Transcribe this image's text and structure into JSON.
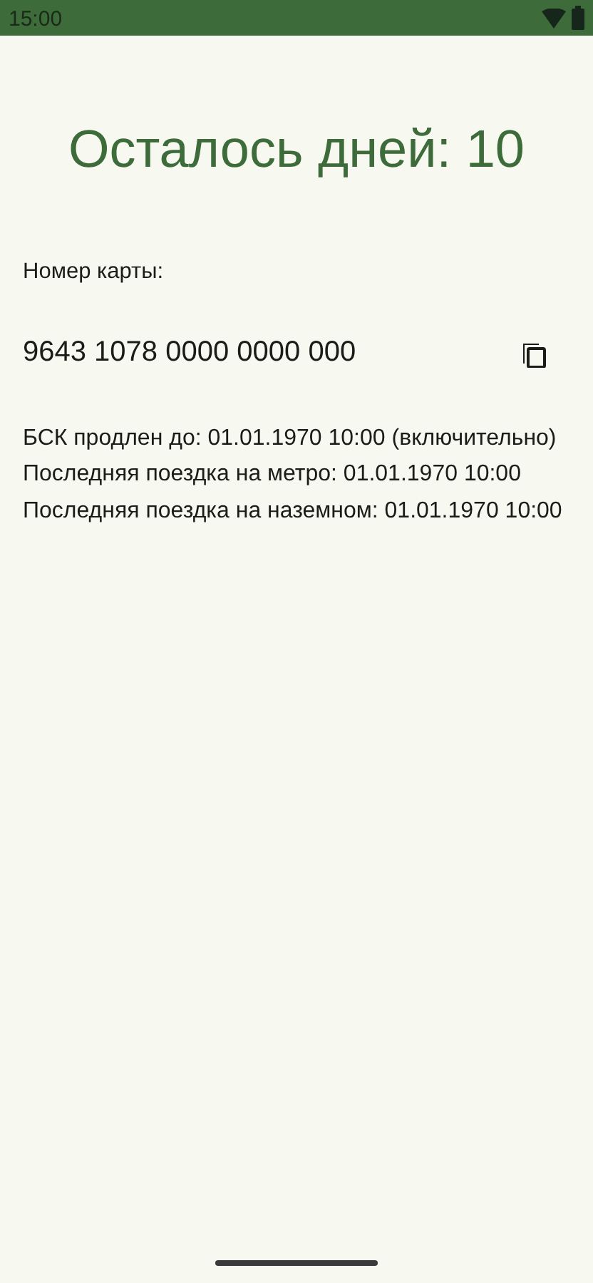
{
  "status_bar": {
    "time": "15:00"
  },
  "days_left": "Осталось дней: 10",
  "card_label": "Номер карты:",
  "card_number": "9643 1078 0000 0000 000",
  "info_lines": [
    "БСК продлен до: 01.01.1970 10:00 (включительно)",
    "Последняя поездка на метро: 01.01.1970 10:00",
    "Последняя поездка на наземном: 01.01.1970 10:00"
  ]
}
